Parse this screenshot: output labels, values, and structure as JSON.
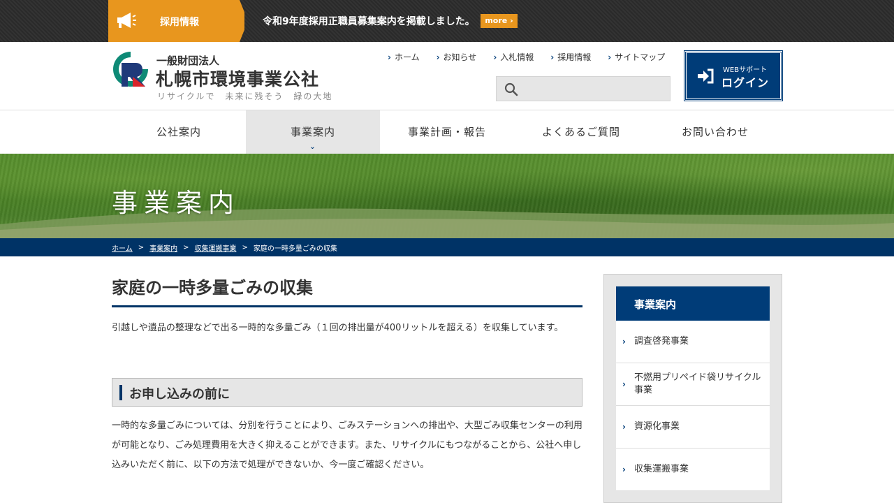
{
  "topbar": {
    "tag_label": "採用情報",
    "tag_icon": "megaphone-icon",
    "message": "令和9年度採用正職員募集案内を掲載しました。",
    "more_label": "more",
    "accent_color": "#e8961e"
  },
  "header": {
    "logo_sub": "一般財団法人",
    "logo_title": "札幌市環境事業公社",
    "logo_tagline": "リサイクルで　未来に残そう　緑の大地",
    "util_nav": [
      {
        "label": "ホーム"
      },
      {
        "label": "お知らせ"
      },
      {
        "label": "入札情報"
      },
      {
        "label": "採用情報"
      },
      {
        "label": "サイトマップ"
      }
    ],
    "search_placeholder": "",
    "login_sub": "WEBサポート",
    "login_label": "ログイン"
  },
  "gnav": [
    {
      "label": "公社案内",
      "active": false
    },
    {
      "label": "事業案内",
      "active": true
    },
    {
      "label": "事業計画・報告",
      "active": false
    },
    {
      "label": "よくあるご質問",
      "active": false
    },
    {
      "label": "お問い合わせ",
      "active": false
    }
  ],
  "hero": {
    "title": "事業案内"
  },
  "breadcrumb": [
    {
      "label": "ホーム",
      "link": true
    },
    {
      "label": "事業案内",
      "link": true
    },
    {
      "label": "収集運搬事業",
      "link": true
    },
    {
      "label": "家庭の一時多量ごみの収集",
      "link": false
    }
  ],
  "main": {
    "title": "家庭の一時多量ごみの収集",
    "intro": "引越しや遺品の整理などで出る一時的な多量ごみ（１回の排出量が400リットルを超える）を収集しています。",
    "section_title": "お申し込みの前に",
    "section_body": "一時的な多量ごみについては、分別を行うことにより、ごみステーションへの排出や、大型ごみ収集センターの利用が可能となり、ごみ処理費用を大きく抑えることができます。また、リサイクルにもつながることから、公社へ申し込みいただく前に、以下の方法で処理ができないか、今一度ご確認ください。"
  },
  "sidebar": {
    "title": "事業案内",
    "items": [
      {
        "label": "調査啓発事業"
      },
      {
        "label": "不燃用プリペイド袋リサイクル事業"
      },
      {
        "label": "資源化事業"
      },
      {
        "label": "収集運搬事業"
      }
    ]
  },
  "colors": {
    "navy": "#003366",
    "brand_blue": "#003c78",
    "orange": "#e8961e",
    "teal": "#0e8a76",
    "red": "#d9262c"
  }
}
